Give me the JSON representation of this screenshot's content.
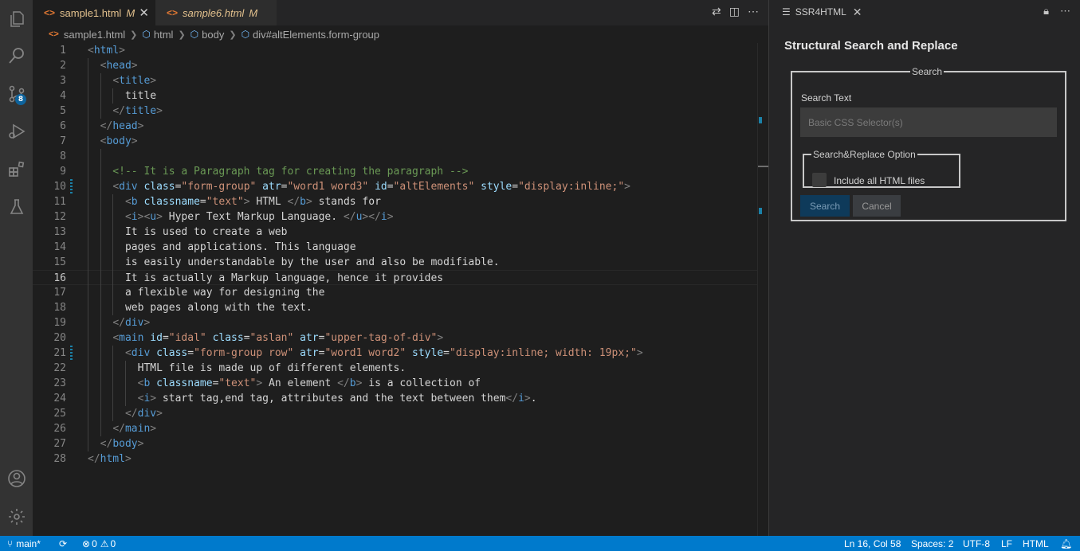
{
  "activity": {
    "icons": [
      "explorer-icon",
      "search-icon",
      "source-control-icon",
      "run-debug-icon",
      "extensions-icon",
      "testing-icon",
      "account-icon",
      "manage-gear-icon"
    ],
    "scm_badge": "8"
  },
  "tabs": [
    {
      "name": "sample1.html",
      "modified": "M"
    },
    {
      "name": "sample6.html",
      "modified": "M"
    }
  ],
  "breadcrumb": [
    "sample1.html",
    "html",
    "body",
    "div#altElements.form-group"
  ],
  "editor": {
    "current_line": 16,
    "lines": [
      "<html>",
      "  <head>",
      "    <title>",
      "      title",
      "    </title>",
      "  </head>",
      "  <body>",
      "",
      "    <!-- It is a Paragraph tag for creating the paragraph -->",
      "    <div class=\"form-group\" atr=\"word1 word3\" id=\"altElements\" style=\"display:inline;\">",
      "      <b classname=\"text\"> HTML </b> stands for",
      "      <i><u> Hyper Text Markup Language. </u></i>",
      "      It is used to create a web",
      "      pages and applications. This language",
      "      is easily understandable by the user and also be modifiable.",
      "      It is actually a Markup language, hence it provides",
      "      a flexible way for designing the",
      "      web pages along with the text.",
      "    </div>",
      "    <main id=\"idal\" class=\"aslan\" atr=\"upper-tag-of-div\">",
      "      <div class=\"form-group row\" atr=\"word1 word2\" style=\"display:inline; width: 19px;\">",
      "        HTML file is made up of different elements.",
      "        <b classname=\"text\"> An element </b> is a collection of",
      "        <i> start tag,end tag, attributes and the text between them</i>.",
      "      </div>",
      "    </main>",
      "  </body>",
      "</html>"
    ]
  },
  "panel": {
    "tab_title": "SSR4HTML",
    "heading": "Structural Search and Replace",
    "search_legend": "Search",
    "search_text_label": "Search Text",
    "search_placeholder": "Basic CSS Selector(s)",
    "option_legend": "Search&Replace Option",
    "include_all_label": "Include all HTML files",
    "search_button": "Search",
    "cancel_button": "Cancel"
  },
  "status": {
    "branch": "main*",
    "errors": "0",
    "warnings": "0",
    "position": "Ln 16, Col 58",
    "spaces": "Spaces: 2",
    "encoding": "UTF-8",
    "eol": "LF",
    "language": "HTML"
  },
  "colors": {
    "status_bar": "#007acc",
    "editor_bg": "#1e1e1e",
    "tag": "#569cd6",
    "attribute": "#9cdcfe",
    "string": "#ce9178",
    "comment": "#6a9955"
  }
}
